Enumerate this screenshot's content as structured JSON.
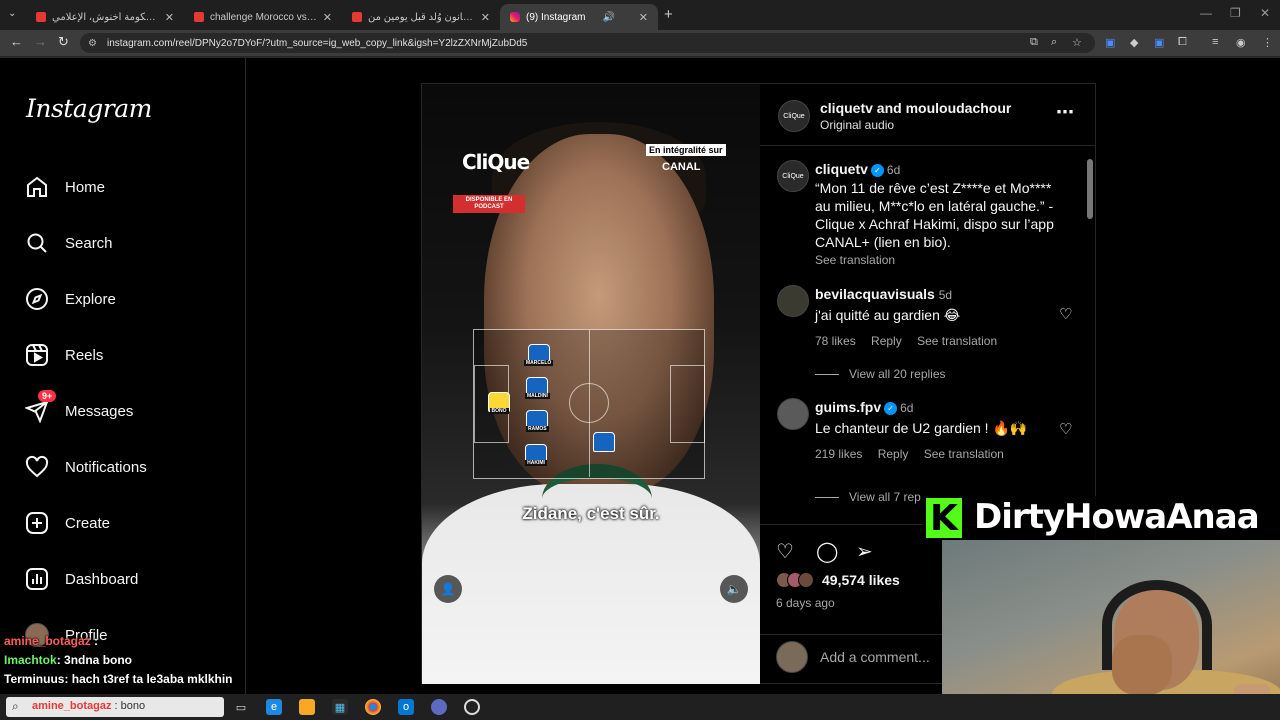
{
  "browser": {
    "tabs": [
      {
        "title": "باي باي حكومة أخنوش، الإعلامي",
        "active": false
      },
      {
        "title": "challenge Morocco vs Egypt",
        "active": false
      },
      {
        "title": "خطير! قانون وُلد قبل يومين من",
        "active": false
      },
      {
        "title": "(9) Instagram",
        "active": true
      }
    ],
    "url": "instagram.com/reel/DPNy2o7DYoF/?utm_source=ig_web_copy_link&igsh=Y2lzZXNrMjZubDd5"
  },
  "sidebar": {
    "logo": "Instagram",
    "items": [
      {
        "label": "Home",
        "icon": "home-icon"
      },
      {
        "label": "Search",
        "icon": "search-icon"
      },
      {
        "label": "Explore",
        "icon": "compass-icon"
      },
      {
        "label": "Reels",
        "icon": "reels-icon"
      },
      {
        "label": "Messages",
        "icon": "messages-icon",
        "badge": "9+"
      },
      {
        "label": "Notifications",
        "icon": "heart-icon"
      },
      {
        "label": "Create",
        "icon": "plus-square-icon"
      },
      {
        "label": "Dashboard",
        "icon": "dashboard-icon"
      },
      {
        "label": "Profile",
        "icon": "avatar"
      }
    ]
  },
  "video": {
    "brand": "CliQue",
    "podcast_badge": "DISPONIBLE EN PODCAST",
    "canal_top": "En intégralité sur",
    "canal_bottom": "CANAL",
    "subtitle": "Zidane, c'est sûr.",
    "players": [
      "MARCELO",
      "MALDINI",
      "RAMOS",
      "HAKIMI",
      "BONO"
    ]
  },
  "post": {
    "header": {
      "users": "cliquetv and mouloudachour",
      "audio": "Original audio"
    },
    "caption": {
      "username": "cliquetv",
      "time": "6d",
      "text": "“Mon 11 de rêve c’est Z****e et Mo**** au milieu, M**c*lo en latéral gauche.” - Clique x Achraf Hakimi, dispo sur l’app CANAL+ (lien en bio).",
      "see_translation": "See translation"
    },
    "comments": [
      {
        "username": "bevilacquavisuals",
        "time": "5d",
        "text": "j'ai quitté au gardien 😂",
        "likes": "78 likes",
        "reply": "Reply",
        "translate": "See translation",
        "view_replies": "View all 20 replies"
      },
      {
        "username": "guims.fpv",
        "time": "6d",
        "text": "Le chanteur de U2 gardien ! 🔥🙌",
        "likes": "219 likes",
        "reply": "Reply",
        "translate": "See translation",
        "view_replies": "View all 7 rep"
      }
    ],
    "likes": "49,574 likes",
    "date": "6 days ago",
    "add_comment_placeholder": "Add a comment..."
  },
  "stream": {
    "channel_name": "DirtyHowaAnaa",
    "chat": [
      {
        "user": "amine_botagaz",
        "text": ":"
      },
      {
        "user": "Imachtok",
        "text": ": 3ndna bono"
      },
      {
        "user": "Terminuus",
        "text": ": hach t3ref ta le3aba mklkhin"
      },
      {
        "user": "amine_botagaz",
        "text": ": bono"
      }
    ]
  },
  "colors": {
    "badge": "#ff3040",
    "verified": "#0095f6",
    "kick_green": "#53fc18"
  }
}
